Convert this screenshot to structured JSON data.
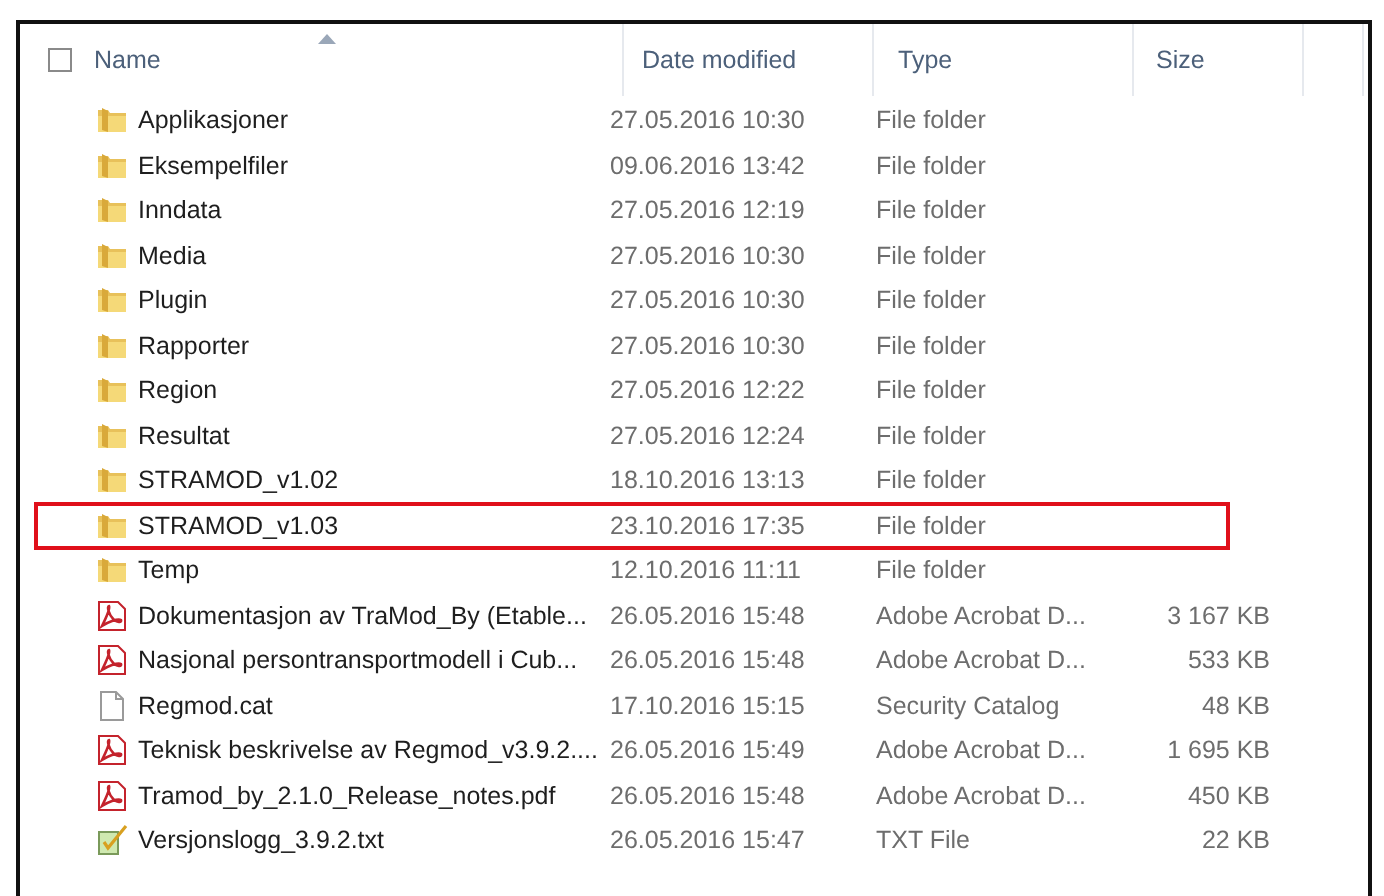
{
  "columns": [
    "Name",
    "Date modified",
    "Type",
    "Size"
  ],
  "select_all": {
    "checked": false
  },
  "rows": [
    {
      "kind": "folder",
      "name": "Applikasjoner",
      "date": "27.05.2016 10:30",
      "type": "File folder",
      "highlighted": false
    },
    {
      "kind": "folder",
      "name": "Eksempelfiler",
      "date": "09.06.2016 13:42",
      "type": "File folder",
      "highlighted": false
    },
    {
      "kind": "folder",
      "name": "Inndata",
      "date": "27.05.2016 12:19",
      "type": "File folder",
      "highlighted": false
    },
    {
      "kind": "folder",
      "name": "Media",
      "date": "27.05.2016 10:30",
      "type": "File folder",
      "highlighted": false
    },
    {
      "kind": "folder",
      "name": "Plugin",
      "date": "27.05.2016 10:30",
      "type": "File folder",
      "highlighted": false
    },
    {
      "kind": "folder",
      "name": "Rapporter",
      "date": "27.05.2016 10:30",
      "type": "File folder",
      "highlighted": false
    },
    {
      "kind": "folder",
      "name": "Region",
      "date": "27.05.2016 12:22",
      "type": "File folder",
      "highlighted": false
    },
    {
      "kind": "folder",
      "name": "Resultat",
      "date": "27.05.2016 12:24",
      "type": "File folder",
      "highlighted": false
    },
    {
      "kind": "folder",
      "name": "STRAMOD_v1.02",
      "date": "18.10.2016 13:13",
      "type": "File folder",
      "highlighted": false
    },
    {
      "kind": "folder",
      "name": "STRAMOD_v1.03",
      "date": "23.10.2016 17:35",
      "type": "File folder",
      "highlighted": true
    },
    {
      "kind": "folder",
      "name": "Temp",
      "date": "12.10.2016 11:11",
      "type": "File folder",
      "highlighted": false
    },
    {
      "kind": "pdf",
      "name": "Dokumentasjon av TraMod_By (Etable...",
      "date": "26.05.2016 15:48",
      "type": "Adobe Acrobat D...",
      "size": "3 167 KB",
      "highlighted": false
    },
    {
      "kind": "pdf",
      "name": "Nasjonal persontransportmodell i Cub...",
      "date": "26.05.2016 15:48",
      "type": "Adobe Acrobat D...",
      "size": "533 KB",
      "highlighted": false
    },
    {
      "kind": "file",
      "name": "Regmod.cat",
      "date": "17.10.2016 15:15",
      "type": "Security Catalog",
      "size": "48 KB",
      "highlighted": false
    },
    {
      "kind": "pdf",
      "name": "Teknisk beskrivelse av Regmod_v3.9.2....",
      "date": "26.05.2016 15:49",
      "type": "Adobe Acrobat D...",
      "size": "1 695 KB",
      "highlighted": false
    },
    {
      "kind": "pdf",
      "name": "Tramod_by_2.1.0_Release_notes.pdf",
      "date": "26.05.2016 15:48",
      "type": "Adobe Acrobat D...",
      "size": "450 KB",
      "highlighted": false
    },
    {
      "kind": "txt",
      "name": "Versjonslogg_3.9.2.txt",
      "date": "26.05.2016 15:47",
      "type": "TXT File",
      "size": "22 KB",
      "highlighted": false
    }
  ]
}
